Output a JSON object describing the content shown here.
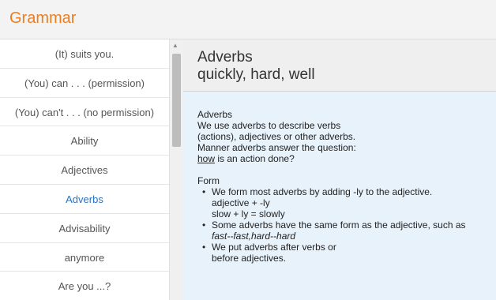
{
  "header": {
    "title": "Grammar"
  },
  "sidebar": {
    "items": [
      {
        "label": "(It) suits you."
      },
      {
        "label": "(You) can . . . (permission)"
      },
      {
        "label": "(You) can't . . . (no permission)"
      },
      {
        "label": "Ability"
      },
      {
        "label": "Adjectives"
      },
      {
        "label": "Adverbs"
      },
      {
        "label": "Advisability"
      },
      {
        "label": "anymore"
      },
      {
        "label": "Are you ...?"
      }
    ],
    "active_index": 5
  },
  "content": {
    "title": "Adverbs",
    "subtitle": "quickly, hard, well",
    "intro": {
      "heading": "Adverbs",
      "line1": "We use adverbs to describe verbs",
      "line2": "(actions), adjectives or other adverbs.",
      "line3": "Manner adverbs answer the question:",
      "line4_underlined": "how",
      "line4_rest": " is an action done?"
    },
    "form": {
      "heading": "Form",
      "bullet1": "We form most adverbs by adding -ly to the adjective.",
      "bullet1_sub1": "adjective + -ly",
      "bullet1_sub2": "slow + ly = slowly",
      "bullet2": "Some adverbs have the same form as the adjective, such as",
      "bullet2_sub_italic": "fast--fast,hard--hard",
      "bullet3": "We put adverbs after verbs or",
      "bullet3_sub": "before adjectives."
    }
  },
  "colors": {
    "accent": "#ee7d1f",
    "active": "#2a73c5",
    "content_bg": "#e8f2fb"
  }
}
